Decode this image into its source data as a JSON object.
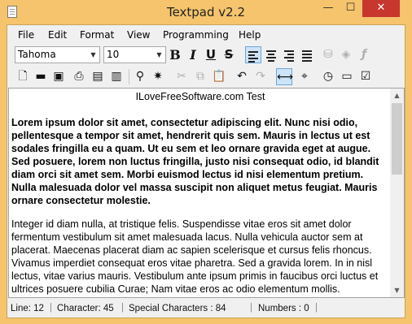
{
  "window": {
    "title": "Textpad v2.2",
    "minimize": "—",
    "maximize": "☐",
    "close": "✕"
  },
  "menu": [
    "File",
    "Edit",
    "Format",
    "View",
    "Programming",
    "Help"
  ],
  "toolbar": {
    "font_name": "Tahoma",
    "font_size": "10",
    "bold": "B",
    "italic": "I",
    "underline": "U",
    "strike": "S",
    "icons": [
      "new-file-icon",
      "open-folder-icon",
      "save-icon",
      "print-icon",
      "print-preview-icon",
      "document-icon",
      "find-icon",
      "magic-wand-icon",
      "cut-icon",
      "copy-icon",
      "paste-icon",
      "undo-icon",
      "redo-icon",
      "word-wrap-icon",
      "location-pin-icon",
      "clock-icon",
      "monitor-icon",
      "checkbox-icon"
    ]
  },
  "document": {
    "title": "ILoveFreeSoftware.com Test",
    "bold_paragraph": "Lorem ipsum dolor sit amet, consectetur adipiscing elit. Nunc nisi odio, pellentesque a tempor sit amet, hendrerit quis sem. Mauris in lectus ut est sodales fringilla eu a quam. Ut eu sem et leo ornare gravida eget at augue. Sed posuere, lorem non luctus fringilla, justo nisi consequat odio, id blandit diam orci sit amet sem. Morbi euismod lectus id nisi elementum pretium. Nulla malesuada dolor vel massa suscipit non aliquet metus feugiat. Mauris ornare consectetur molestie.",
    "normal_paragraph": "Integer id diam nulla, at tristique felis. Suspendisse vitae eros sit amet dolor fermentum vestibulum sit amet malesuada lacus. Nulla vehicula auctor sem at placerat. Maecenas placerat diam ac sapien scelerisque et cursus felis rhoncus. Vivamus imperdiet consequat eros vitae pharetra. Sed a gravida lorem. In in nisl lectus, vitae varius mauris. Vestibulum ante ipsum primis in faucibus orci luctus et ultrices posuere cubilia Curae; Nam vitae eros ac odio elementum mollis."
  },
  "status": {
    "line": "Line: 12",
    "character": "Character: 45",
    "special": "Special Characters : 84",
    "numbers": "Numbers : 0",
    "separator": "|"
  },
  "colors": {
    "frame": "#f5c46c",
    "close_button": "#c7372e",
    "active_button": "#cde4f7"
  }
}
